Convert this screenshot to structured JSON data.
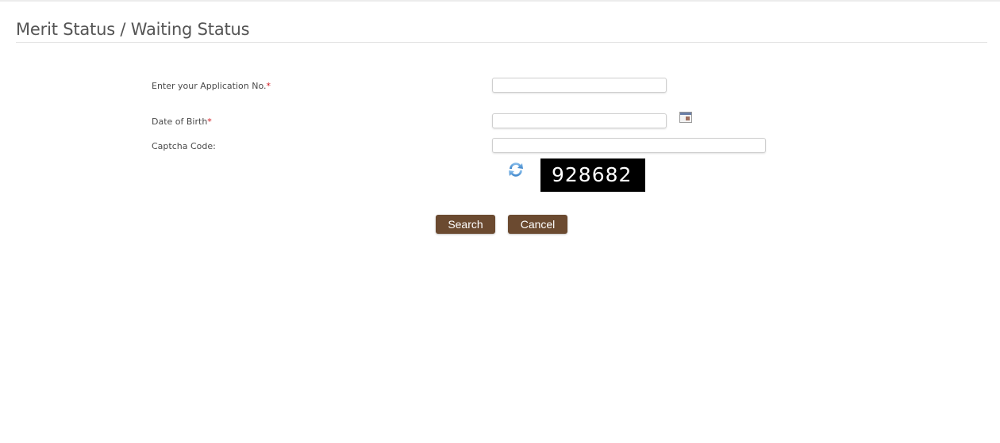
{
  "page": {
    "title": "Merit Status / Waiting Status"
  },
  "form": {
    "application_no": {
      "label": "Enter your Application No.",
      "required_mark": "*",
      "value": ""
    },
    "dob": {
      "label": "Date of Birth",
      "required_mark": "*",
      "value": "",
      "icon": "calendar-icon"
    },
    "captcha": {
      "label": "Captcha Code:",
      "value": "",
      "image_text": "928682",
      "refresh_icon": "refresh-icon"
    }
  },
  "actions": {
    "search_label": "Search",
    "cancel_label": "Cancel"
  },
  "colors": {
    "button_bg": "#6b4a30",
    "required": "#d0191f"
  }
}
